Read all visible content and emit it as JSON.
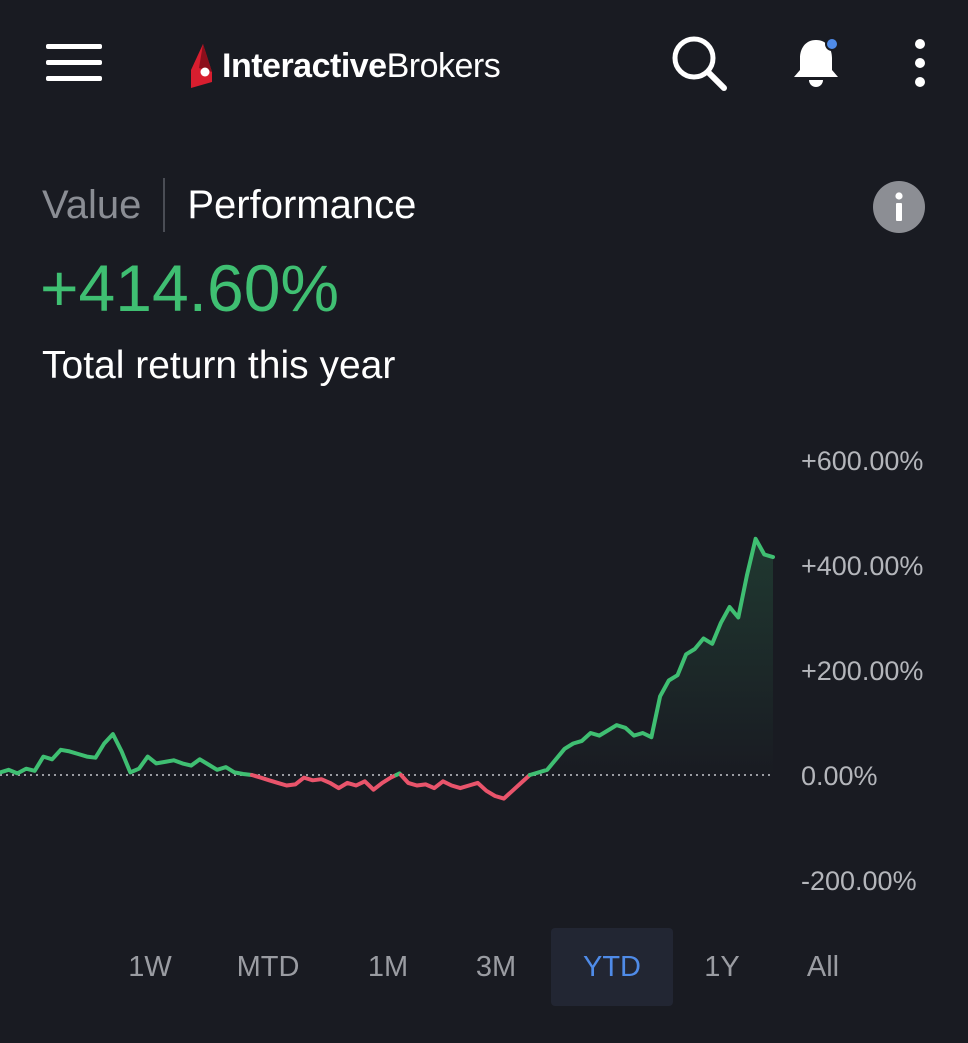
{
  "header": {
    "logo_bold": "Interactive",
    "logo_regular": "Brokers",
    "icons": [
      "menu-icon",
      "search-icon",
      "bell-icon",
      "more-vertical-icon"
    ],
    "notification_dot_color": "#4f8be8"
  },
  "tabs": {
    "value_label": "Value",
    "performance_label": "Performance",
    "active": "Performance"
  },
  "summary": {
    "return_value": "+414.60%",
    "return_caption": "Total return this year",
    "positive_color": "#3fbf72",
    "negative_color": "#e9546b"
  },
  "ranges": [
    {
      "label": "1W",
      "active": false
    },
    {
      "label": "MTD",
      "active": false
    },
    {
      "label": "1M",
      "active": false
    },
    {
      "label": "3M",
      "active": false
    },
    {
      "label": "YTD",
      "active": true
    },
    {
      "label": "1Y",
      "active": false
    },
    {
      "label": "All",
      "active": false
    }
  ],
  "chart_data": {
    "type": "line",
    "ylim": [
      -200,
      600
    ],
    "yticks": [
      "+600.00%",
      "+400.00%",
      "+200.00%",
      "0.00%",
      "-200.00%"
    ],
    "ytick_values": [
      600,
      400,
      200,
      0,
      -200
    ],
    "baseline": 0,
    "grid": false,
    "axis_position": "right",
    "series": [
      {
        "values": [
          5,
          10,
          3,
          12,
          8,
          35,
          30,
          48,
          45,
          40,
          35,
          33,
          60,
          78,
          45,
          5,
          12,
          35,
          22,
          25,
          28,
          22,
          18,
          30,
          20,
          10,
          15,
          5,
          2,
          0,
          -5,
          -10,
          -15,
          -20,
          -18,
          -5,
          -10,
          -8,
          -15,
          -25,
          -15,
          -20,
          -12,
          -28,
          -15,
          -5,
          3,
          -15,
          -20,
          -18,
          -25,
          -12,
          -20,
          -25,
          -20,
          -15,
          -30,
          -40,
          -45,
          -30,
          -15,
          0,
          5,
          10,
          30,
          50,
          60,
          65,
          80,
          75,
          85,
          95,
          90,
          75,
          80,
          72,
          150,
          180,
          190,
          230,
          240,
          260,
          250,
          290,
          320,
          300,
          380,
          450,
          420,
          415
        ]
      }
    ]
  }
}
